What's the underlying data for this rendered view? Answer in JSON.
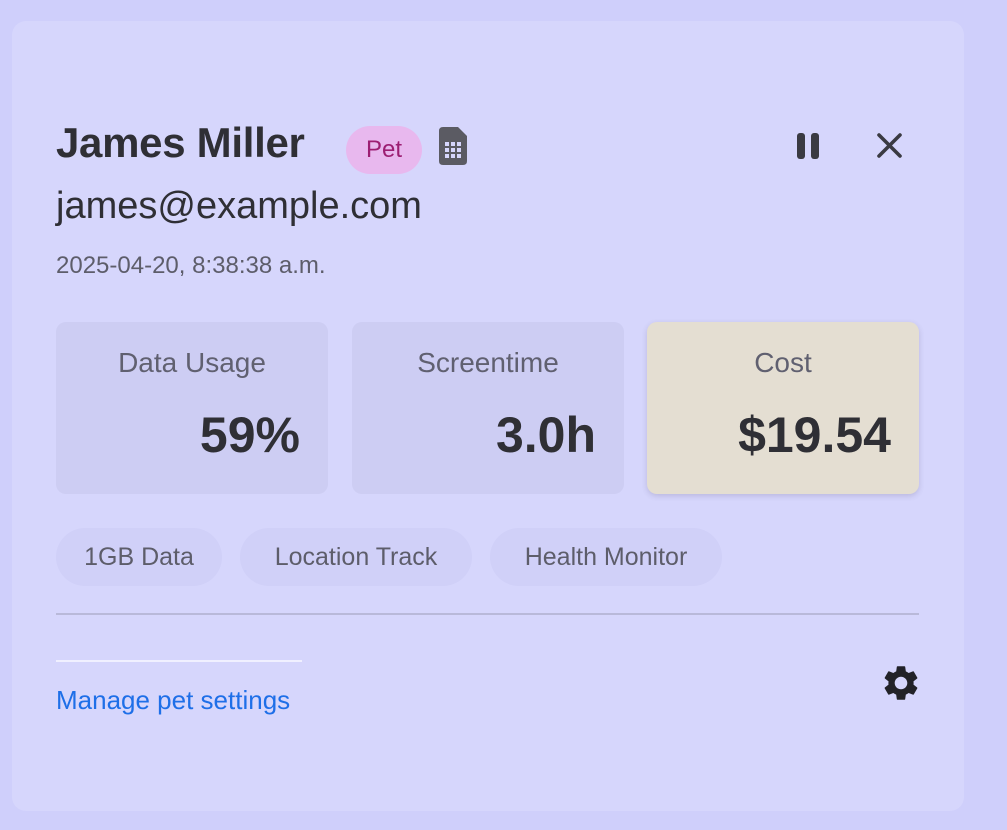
{
  "profile": {
    "name": "James Miller",
    "badge": "Pet",
    "email": "james@example.com",
    "timestamp": "2025-04-20, 8:38:38 a.m."
  },
  "stats": [
    {
      "label": "Data Usage",
      "value": "59%"
    },
    {
      "label": "Screentime",
      "value": "3.0h"
    },
    {
      "label": "Cost",
      "value": "$19.54"
    }
  ],
  "features": [
    "1GB Data",
    "Location Track",
    "Health Monitor"
  ],
  "footer": {
    "link_label": "Manage pet settings"
  },
  "icons": {
    "sim": "sim-card-icon",
    "pause": "pause-icon",
    "close": "close-icon",
    "settings": "gear-icon"
  },
  "colors": {
    "badge_bg": "#e8b8ee",
    "badge_text": "#9c1e72",
    "link": "#1e6fe8",
    "highlight_stat": "#e4ded2"
  }
}
